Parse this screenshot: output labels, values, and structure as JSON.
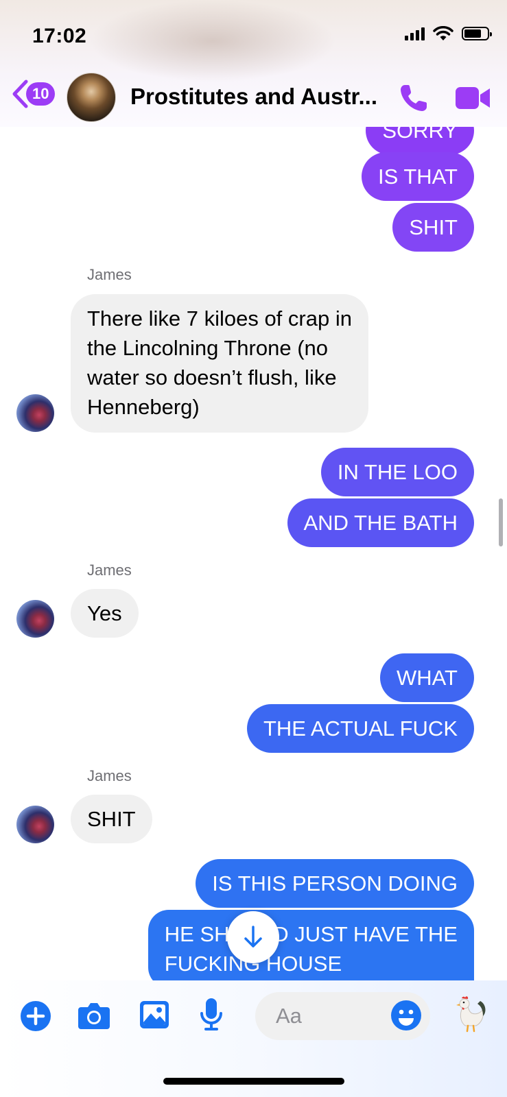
{
  "status_bar": {
    "time": "17:02"
  },
  "header": {
    "back_badge": "10",
    "title": "Prostitutes and Austr...",
    "accent_color": "#9c3cf5",
    "icons": [
      "chevron-left-icon",
      "phone-icon",
      "video-camera-icon"
    ]
  },
  "messages": [
    {
      "from": "me",
      "text": "SORRY",
      "color": "#8b3df5"
    },
    {
      "from": "me",
      "text": "IS THAT",
      "color": "#8842f5"
    },
    {
      "from": "me",
      "text": "SHIT",
      "color": "#8346f5"
    },
    {
      "from": "James",
      "sender": "James",
      "lines": [
        "There like 7 kiloes of crap in",
        "the Lincolning Throne (no",
        "water so doesn’t flush, like",
        "Henneberg)"
      ]
    },
    {
      "from": "me",
      "text": "IN THE LOO",
      "color": "#6153f3"
    },
    {
      "from": "me",
      "text": "AND THE BATH",
      "color": "#5a55f3"
    },
    {
      "from": "James",
      "sender": "James",
      "text": "Yes"
    },
    {
      "from": "me",
      "text": "WHAT",
      "color": "#3f66f2"
    },
    {
      "from": "me",
      "text": "THE ACTUAL FUCK",
      "color": "#3c68f2"
    },
    {
      "from": "James",
      "sender": "James",
      "text": "SHIT"
    },
    {
      "from": "me",
      "text": "IS THIS PERSON DOING",
      "color": "#2f72f2"
    },
    {
      "from": "me",
      "lines": [
        "HE SHOULD JUST HAVE THE",
        "FUCKING HOUSE"
      ],
      "color": "#2c75f2"
    }
  ],
  "composer": {
    "placeholder": "Aa",
    "tool_color": "#1a73f2",
    "icons": [
      "plus-icon",
      "camera-icon",
      "image-icon",
      "microphone-icon",
      "emoji-icon",
      "rooster-icon"
    ],
    "quick_reaction": "🐓"
  },
  "scroll_down_icon": "arrow-down-icon"
}
